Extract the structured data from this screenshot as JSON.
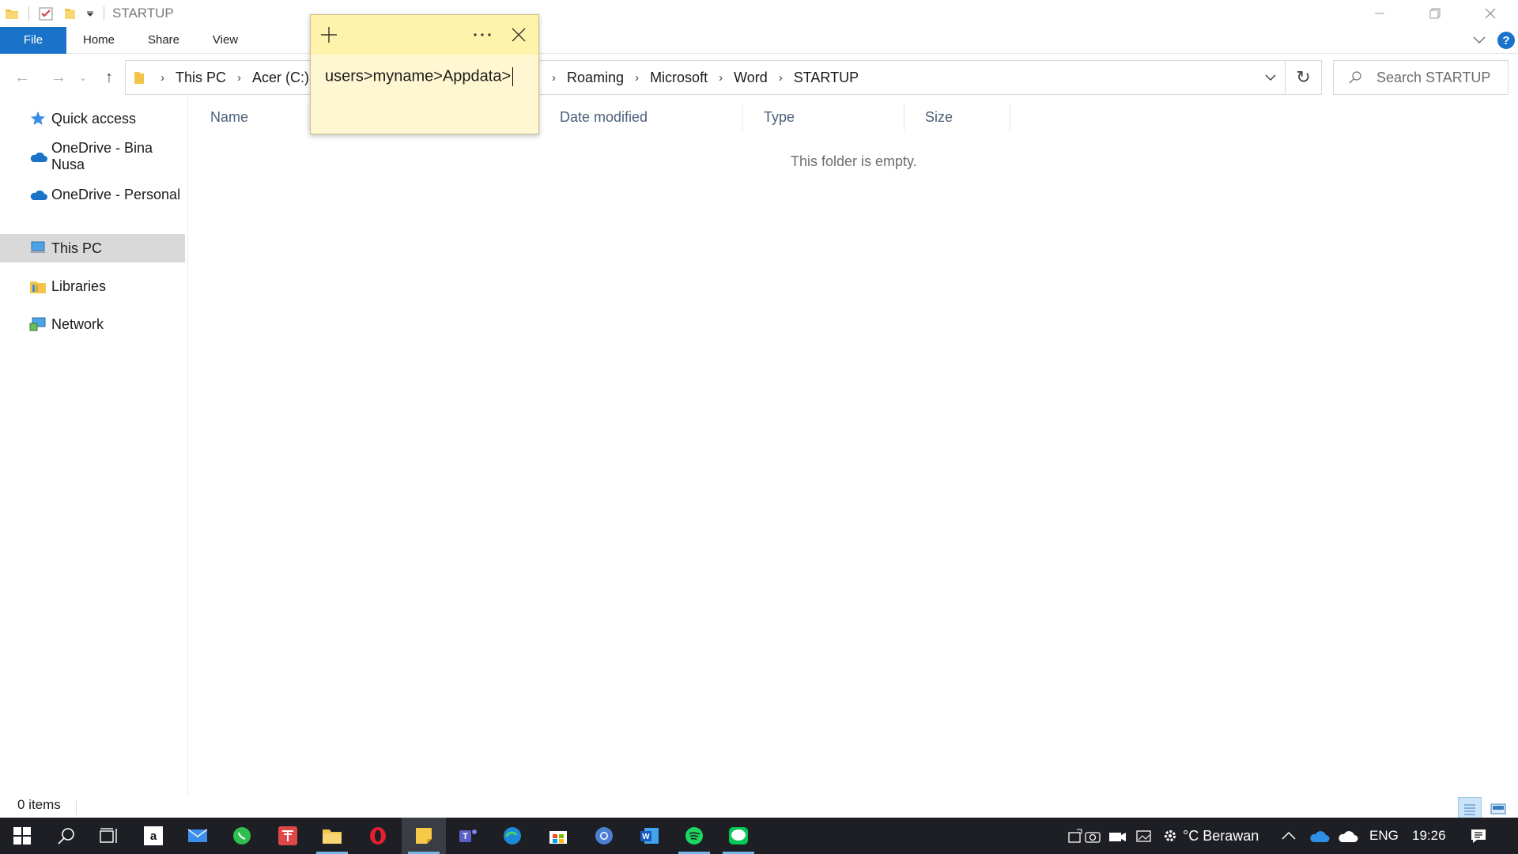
{
  "window": {
    "title": "STARTUP",
    "controls": {
      "minimize": "minimize-icon",
      "restore": "restore-icon",
      "close": "close-icon"
    }
  },
  "ribbon": {
    "tabs": [
      {
        "label": "File",
        "active": true
      },
      {
        "label": "Home"
      },
      {
        "label": "Share"
      },
      {
        "label": "View"
      }
    ],
    "help_label": "?"
  },
  "address": {
    "crumbs": [
      "This PC",
      "Acer (C:)",
      "Roaming",
      "Microsoft",
      "Word",
      "STARTUP"
    ],
    "search_placeholder": "Search STARTUP"
  },
  "nav_pane": {
    "items": [
      {
        "label": "Quick access",
        "icon": "star-icon"
      },
      {
        "label": "OneDrive - Bina Nusa",
        "icon": "cloud-icon"
      },
      {
        "label": "OneDrive - Personal",
        "icon": "cloud-icon"
      },
      {
        "label": "This PC",
        "icon": "computer-icon",
        "selected": true
      },
      {
        "label": "Libraries",
        "icon": "libraries-icon"
      },
      {
        "label": "Network",
        "icon": "network-icon"
      }
    ]
  },
  "content": {
    "columns": [
      "Name",
      "Date modified",
      "Type",
      "Size"
    ],
    "empty_message": "This folder is empty."
  },
  "status": {
    "item_count": "0 items"
  },
  "sticky_note": {
    "text": "users>myname>Appdata>",
    "note_color": "#fff7d1",
    "bar_color": "#fff2ab"
  },
  "taskbar": {
    "apps": [
      "start-icon",
      "search-icon",
      "task-view-icon",
      "amazon-icon",
      "mail-icon",
      "whatsapp-icon",
      "app-icon",
      "file-explorer-icon",
      "opera-icon",
      "sticky-notes-icon",
      "teams-icon",
      "edge-icon",
      "store-icon",
      "chrome-icon",
      "word-icon",
      "spotify-icon",
      "line-icon"
    ],
    "weather_text": "°C  Berawan",
    "language": "ENG",
    "time": "19:26"
  },
  "colors": {
    "accent": "#1a73c8",
    "taskbar": "#1d1f24"
  }
}
